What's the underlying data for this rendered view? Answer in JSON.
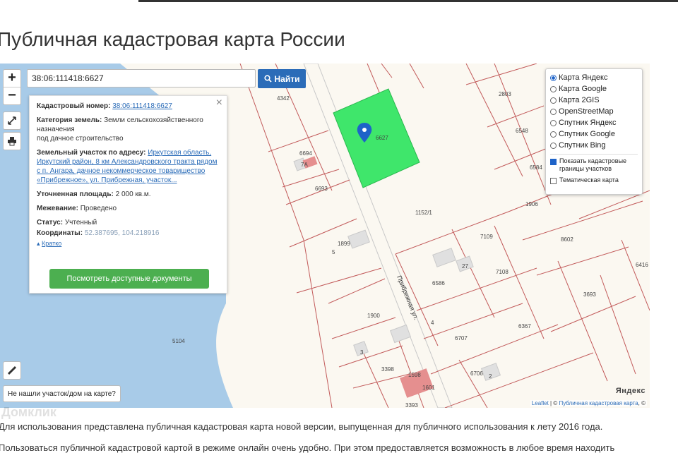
{
  "page": {
    "title": "Публичная кадастровая карта России"
  },
  "search": {
    "value": "38:06:111418:6627",
    "button_label": "Найти"
  },
  "zoom": {
    "plus": "+",
    "minus": "−"
  },
  "info": {
    "close": "×",
    "cadastral_label": "Кадастровый номер:",
    "cadastral_value": "38:06:111418:6627",
    "category_label": "Категория земель:",
    "category_value": "Земли сельскохозяйственного назначения",
    "category_value2": "под дачное строительство",
    "address_label": "Земельный участок по адресу:",
    "address_value": "Иркутская область, Иркутский район, 8 км Александровского тракта рядом с п. Ангара, дачное некоммерческое товарищество «Прибрежное», ул. Прибрежная, участок...",
    "area_label": "Уточненная площадь:",
    "area_value": "2 000 кв.м.",
    "survey_label": "Межевание:",
    "survey_value": "Проведено",
    "status_label": "Статус:",
    "status_value": "Учтенный",
    "coords_label": "Координаты:",
    "coords_value": "52.387695, 104.218916",
    "brief": "Кратко",
    "docs_button": "Посмотреть доступные документы"
  },
  "layers": {
    "base_options": [
      {
        "label": "Карта Яндекс",
        "selected": true
      },
      {
        "label": "Карта Google",
        "selected": false
      },
      {
        "label": "Карта 2GIS",
        "selected": false
      },
      {
        "label": "OpenStreetMap",
        "selected": false
      },
      {
        "label": "Спутник Яндекс",
        "selected": false
      },
      {
        "label": "Спутник Google",
        "selected": false
      },
      {
        "label": "Спутник Bing",
        "selected": false
      }
    ],
    "overlay_cadastral": "Показать кадастровые границы участков",
    "overlay_thematic": "Тематическая карта"
  },
  "map": {
    "plot_labels": [
      "4342",
      "2803",
      "6548",
      "6584",
      "6694",
      "7А",
      "6693",
      "1152/1",
      "1906",
      "8602",
      "1899",
      "5",
      "7109",
      "7108",
      "27",
      "6416",
      "3693",
      "6586",
      "1900",
      "4",
      "6367",
      "6707",
      "3",
      "3398",
      "6706",
      "2",
      "1598",
      "1601",
      "3393",
      "5104",
      "6627"
    ],
    "street": "Прибрежная ул.",
    "brand": "Яндекс",
    "attribution_link1": "Leaflet",
    "attribution_link2": "Публичная кадастровая карта"
  },
  "bottom_buttons": {
    "not_found": "Не нашли участок/дом на карте?"
  },
  "watermark": "Домклик",
  "paragraphs": {
    "p1": "Для использования представлена публичная кадастровая карта новой версии, выпущенная для публичного использования к лету 2016 года.",
    "p2": "Пользоваться публичной кадастровой картой в режиме онлайн очень удобно. При этом предоставляется возможность в любое время находить"
  },
  "colors": {
    "selected_plot": "#3fe66b",
    "water": "#a8cbe8",
    "accent": "#2b6cb8",
    "docs_button": "#4caf50"
  }
}
